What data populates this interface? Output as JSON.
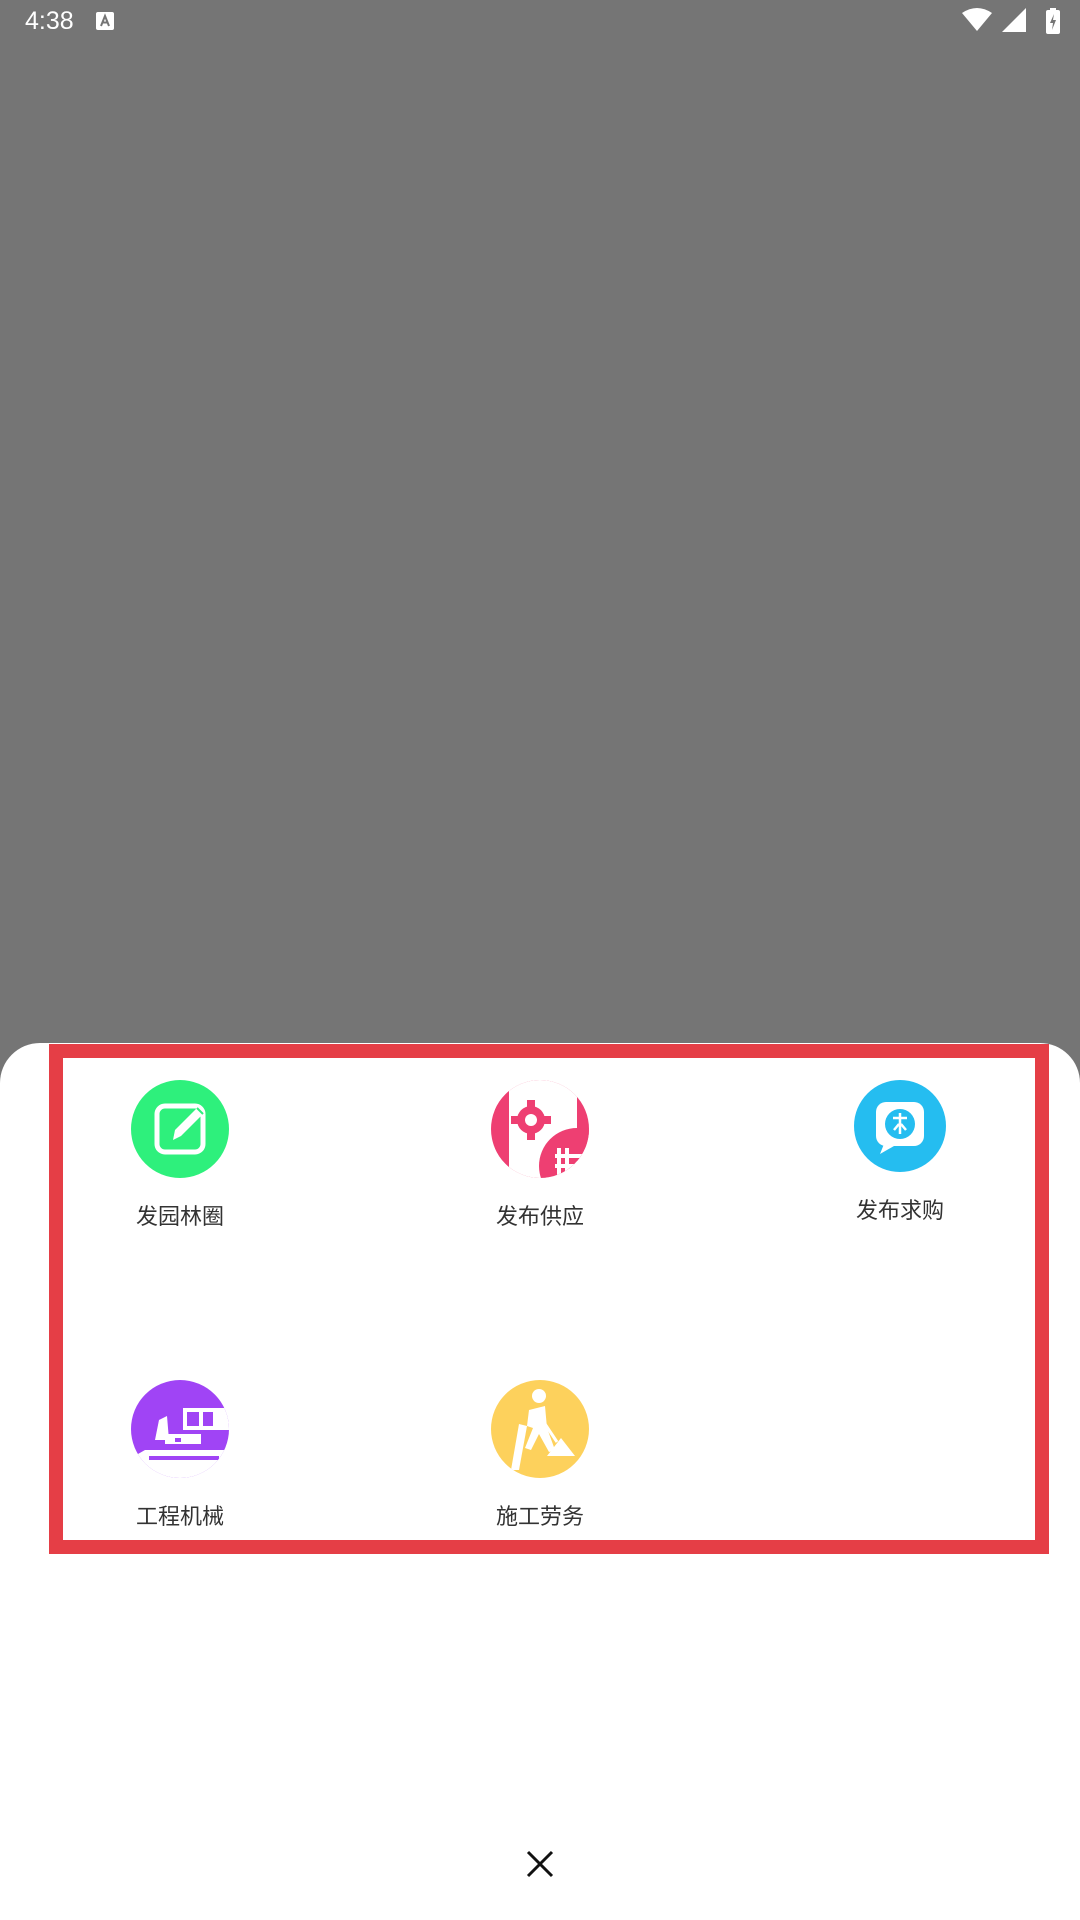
{
  "status_bar": {
    "time": "4:38",
    "icons": [
      "a-notification-icon",
      "wifi-icon",
      "signal-icon",
      "battery-icon"
    ]
  },
  "menu": {
    "items": [
      {
        "label": "发园林圈",
        "icon": "edit-icon",
        "color": "#2ef07c"
      },
      {
        "label": "发布供应",
        "icon": "supply-gear-icon",
        "color": "#ee3f72"
      },
      {
        "label": "发布求购",
        "icon": "request-chat-icon",
        "color": "#25bdf0"
      },
      {
        "label": "工程机械",
        "icon": "machinery-icon",
        "color": "#a044f5"
      },
      {
        "label": "施工劳务",
        "icon": "worker-icon",
        "color": "#fdd15c"
      }
    ]
  },
  "close": {
    "icon": "close-icon"
  },
  "colors": {
    "overlay": "#757575",
    "sheet": "#ffffff",
    "highlight": "#e53e46",
    "label": "#333333"
  }
}
